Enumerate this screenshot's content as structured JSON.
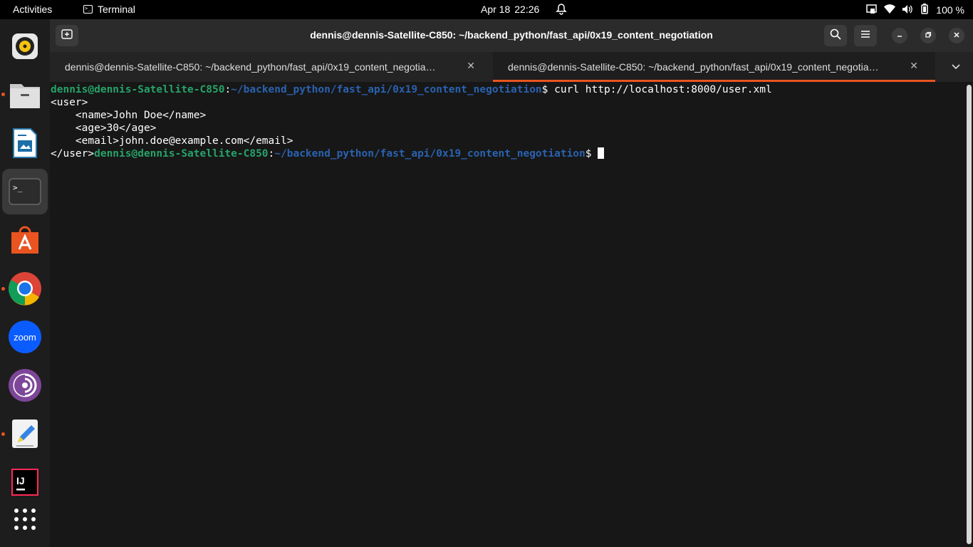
{
  "topbar": {
    "activities": "Activities",
    "app_name": "Terminal",
    "date": "Apr 18",
    "time": "22:26",
    "battery": "100 %"
  },
  "dock": {
    "items": [
      "rhythmbox-icon",
      "files-icon",
      "writer-icon",
      "terminal-icon",
      "app-center-icon",
      "chrome-icon",
      "zoom-icon",
      "tor-icon",
      "text-editor-icon",
      "intellij-icon",
      "show-apps-icon"
    ],
    "zoom_label": "zoom",
    "intellij_label": "IJ"
  },
  "window": {
    "title": "dennis@dennis-Satellite-C850: ~/backend_python/fast_api/0x19_content_negotiation",
    "tabs": [
      {
        "label": "dennis@dennis-Satellite-C850: ~/backend_python/fast_api/0x19_content_negotia…"
      },
      {
        "label": "dennis@dennis-Satellite-C850: ~/backend_python/fast_api/0x19_content_negotia…"
      }
    ]
  },
  "terminal": {
    "prompt_user": "dennis@dennis-Satellite-C850",
    "prompt_path": "~/backend_python/fast_api/0x19_content_negotiation",
    "prompt_sym": "$ ",
    "command": "curl http://localhost:8000/user.xml",
    "output": [
      "<user>",
      "    <name>John Doe</name>",
      "    <age>30</age>",
      "    <email>john.doe@example.com</email>"
    ],
    "last_output": "</user>"
  },
  "colors": {
    "accent": "#e95420",
    "prompt_user": "#26a269",
    "prompt_path": "#2a62b0"
  }
}
